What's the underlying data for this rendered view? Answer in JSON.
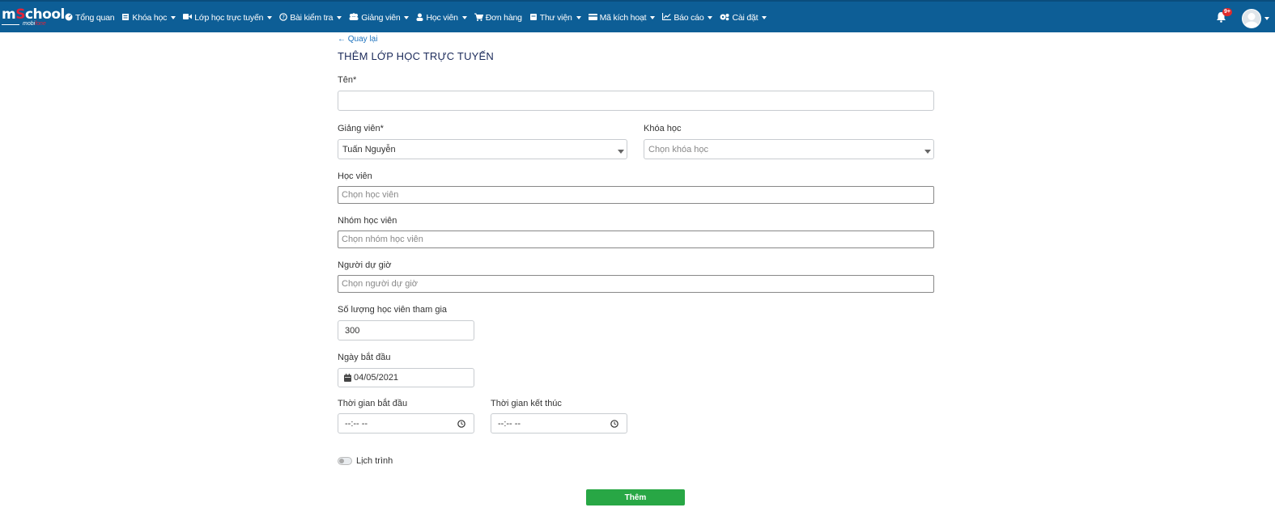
{
  "brand": {
    "logo_main_1": "m",
    "logo_main_o": "S",
    "logo_main_2": "chool",
    "logo_sub_1": "mobi",
    "logo_sub_2": "fone"
  },
  "nav": [
    {
      "icon": "dashboard-icon",
      "label": "Tổng quan",
      "dropdown": false
    },
    {
      "icon": "book-icon",
      "label": "Khóa học",
      "dropdown": true
    },
    {
      "icon": "video-icon",
      "label": "Lớp học trực tuyến",
      "dropdown": true
    },
    {
      "icon": "question-icon",
      "label": "Bài kiểm tra",
      "dropdown": true
    },
    {
      "icon": "users-icon",
      "label": "Giảng viên",
      "dropdown": true
    },
    {
      "icon": "user-icon",
      "label": "Học viên",
      "dropdown": true
    },
    {
      "icon": "cart-icon",
      "label": "Đơn hàng",
      "dropdown": false
    },
    {
      "icon": "library-icon",
      "label": "Thư viện",
      "dropdown": true
    },
    {
      "icon": "card-icon",
      "label": "Mã kích hoạt",
      "dropdown": true
    },
    {
      "icon": "chart-icon",
      "label": "Báo cáo",
      "dropdown": true
    },
    {
      "icon": "cogs-icon",
      "label": "Cài đặt",
      "dropdown": true
    }
  ],
  "notifications": {
    "badge": "9+"
  },
  "page": {
    "back_label": "← Quay lại",
    "title": "THÊM LỚP HỌC TRỰC TUYẾN"
  },
  "form": {
    "name_label": "Tên*",
    "name_value": "",
    "teacher_label": "Giảng viên*",
    "teacher_value": "Tuấn Nguyễn",
    "course_label": "Khóa học",
    "course_placeholder": "Chọn khóa học",
    "students_label": "Học viên",
    "students_placeholder": "Chọn học viên",
    "groups_label": "Nhóm học viên",
    "groups_placeholder": "Chọn nhóm học viên",
    "observers_label": "Người dự giờ",
    "observers_placeholder": "Chọn người dự giờ",
    "max_label": "Số lượng học viên tham gia",
    "max_value": "300",
    "start_date_label": "Ngày bắt đầu",
    "start_date_value": "04/05/2021",
    "start_time_label": "Thời gian bắt đầu",
    "start_time_value": "--:-- --",
    "end_time_label": "Thời gian kết thúc",
    "end_time_value": "--:-- --",
    "schedule_label": "Lịch trình",
    "submit_label": "Thêm"
  },
  "colors": {
    "topbar": "#0d5e96",
    "submit": "#28a745",
    "link": "#1e73be"
  }
}
